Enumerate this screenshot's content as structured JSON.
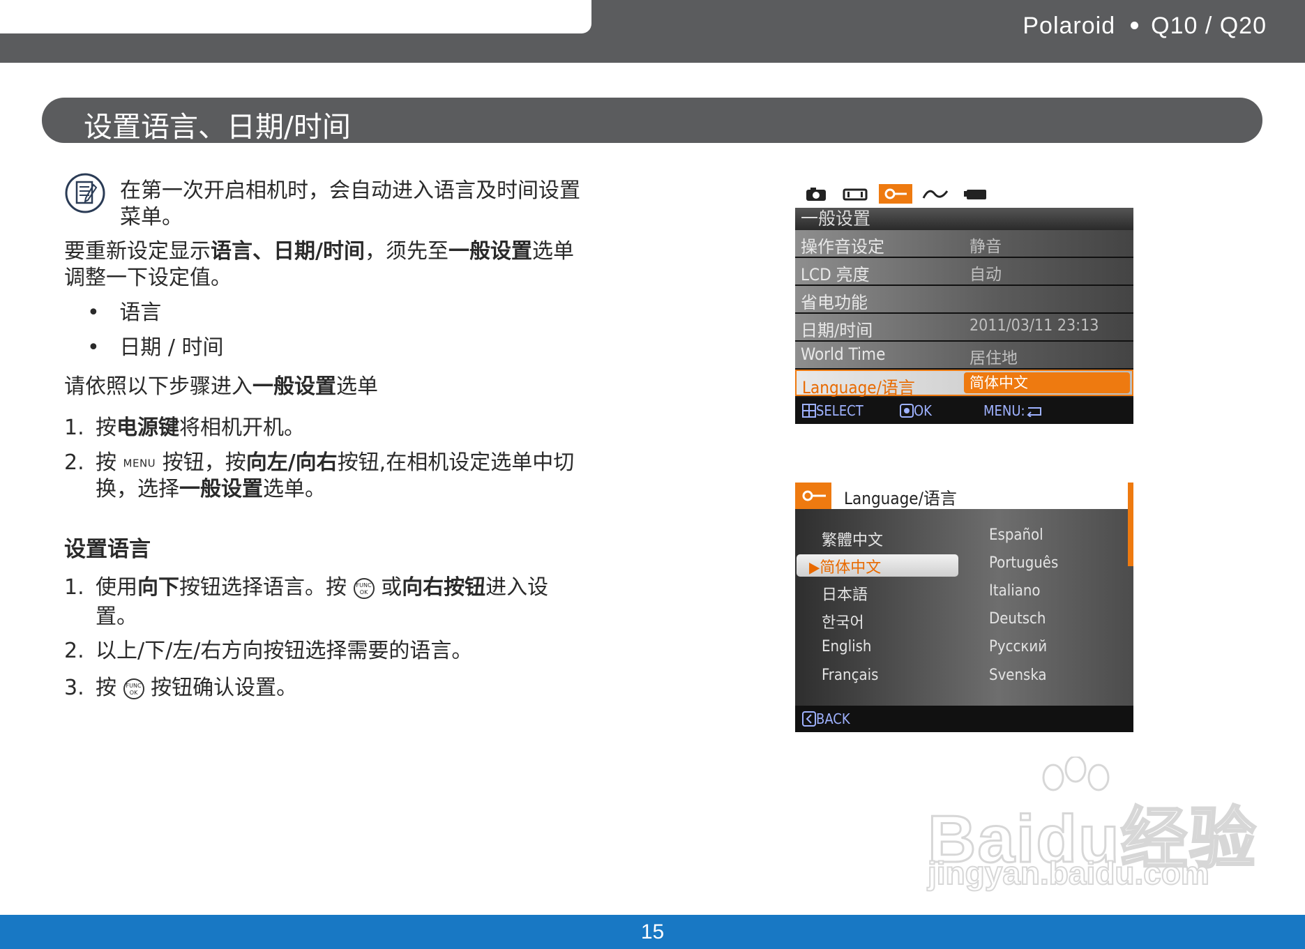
{
  "header": {
    "brand": "Polaroid",
    "model": "Q10 / Q20"
  },
  "section_title": "设置语言、日期/时间",
  "note": {
    "line1": "在第一次开启相机时，会自动进入语言及时间设置",
    "line2": "菜单。"
  },
  "intro": {
    "p1_a": "要重新设定显示",
    "p1_b": "语言、日期/时间",
    "p1_c": "，须先至",
    "p1_d": "一般设置",
    "p1_e": "选单",
    "p1_line2": "调整一下设定值。"
  },
  "bullets": [
    "语言",
    "日期 / 时间"
  ],
  "steps_intro": {
    "a": "请依照以下步骤进入",
    "b": "一般设置",
    "c": "选单"
  },
  "steps": {
    "s1": {
      "num": "1.",
      "a": "按",
      "b": "电源键",
      "c": "将相机开机。"
    },
    "s2": {
      "num": "2.",
      "a": "按",
      "menu": "MENU",
      "b": "按钮，按",
      "c": "向左/向右",
      "d": "按钮,在相机设定选单中切",
      "e": "换，选择",
      "f": "一般设置",
      "g": "选单。"
    }
  },
  "lang_heading": "设置语言",
  "lang_steps": {
    "s1": {
      "num": "1.",
      "a": "使用",
      "b": "向下",
      "c": "按钮选择语言。按",
      "d": "或",
      "e": "向右按钮",
      "f": "进入设",
      "g": "置。"
    },
    "s2": {
      "num": "2.",
      "a": "以上/下/左/右方向按钮选择需要的语言。"
    },
    "s3": {
      "num": "3.",
      "a": "按",
      "b": "按钮确认设置。"
    }
  },
  "func_icon": {
    "top": "FUNC",
    "bottom": "OK"
  },
  "screen1": {
    "section": "一般设置",
    "rows": [
      {
        "k": "操作音设定",
        "v": "静音"
      },
      {
        "k": "LCD 亮度",
        "v": "自动"
      },
      {
        "k": "省电功能",
        "v": ""
      },
      {
        "k": "日期/时间",
        "v": "2011/03/11 23:13"
      },
      {
        "k": "World Time",
        "v": "居住地"
      },
      {
        "k": "Language/语言",
        "v": "简体中文"
      }
    ],
    "footer": {
      "select": "SELECT",
      "ok": "OK",
      "menu": "MENU:"
    }
  },
  "screen2": {
    "title": "Language/语言",
    "left": [
      "繁體中文",
      "简体中文",
      "日本語",
      "한국어",
      "English",
      "Français"
    ],
    "right": [
      "Español",
      "Português",
      "Italiano",
      "Deutsch",
      "Русский",
      "Svenska"
    ],
    "selected": "简体中文",
    "back": "BACK"
  },
  "watermark": {
    "main": "Baidu经验",
    "sub": "jingyan.baidu.com"
  },
  "page_number": "15",
  "colors": {
    "header_gray": "#5b5c5e",
    "accent_orange": "#ee7a10",
    "footer_blue": "#1878c4"
  }
}
